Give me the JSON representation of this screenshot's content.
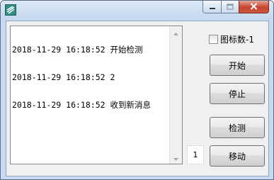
{
  "window": {
    "app_icon": "app-icon",
    "controls": [
      "minimize-icon",
      "maximize-icon",
      "close-icon"
    ]
  },
  "log": {
    "lines": [
      "2018-11-29 16:18:52 开始检测",
      "2018-11-29 16:18:52 2",
      "2018-11-29 16:18:52 收到新消息"
    ]
  },
  "options": {
    "checkbox_label": "图标数-1",
    "checked": false
  },
  "buttons": {
    "start": "开始",
    "stop": "停止",
    "detect": "检测",
    "move": "移动"
  },
  "number_field": {
    "value": "1"
  },
  "colors": {
    "title_bar": "#c7daf0",
    "close_button": "#c5452f",
    "client_bg": "#f0f0f0"
  }
}
